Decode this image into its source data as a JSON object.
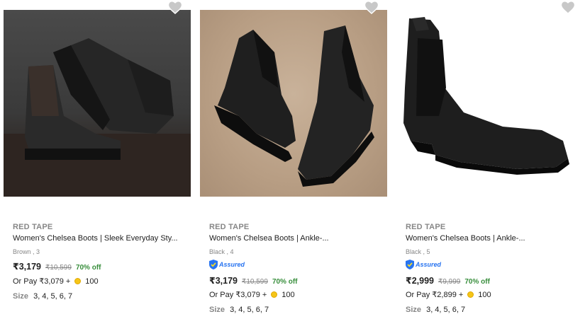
{
  "products": [
    {
      "brand": "RED TAPE",
      "title": "Women's Chelsea Boots | Sleek Everyday Sty...",
      "variant": "Brown , 3",
      "price": "₹3,179",
      "mrp": "₹10,599",
      "discount": "70% off",
      "pay_prefix": "Or Pay ₹3,079 +",
      "coins": "100",
      "size_label": "Size",
      "sizes": "3, 4, 5, 6, 7",
      "assured": false,
      "icons": {
        "wishlist": "heart-icon",
        "coin": "supercoin-icon"
      }
    },
    {
      "brand": "RED TAPE",
      "title": "Women's Chelsea Boots | Ankle-...",
      "variant": "Black , 4",
      "assured_label": "Assured",
      "price": "₹3,179",
      "mrp": "₹10,599",
      "discount": "70% off",
      "pay_prefix": "Or Pay ₹3,079 +",
      "coins": "100",
      "size_label": "Size",
      "sizes": "3, 4, 5, 6, 7",
      "assured": true
    },
    {
      "brand": "RED TAPE",
      "title": "Women's Chelsea Boots | Ankle-...",
      "variant": "Black , 5",
      "assured_label": "Assured",
      "price": "₹2,999",
      "mrp": "₹9,999",
      "discount": "70% off",
      "pay_prefix": "Or Pay ₹2,899 +",
      "coins": "100",
      "size_label": "Size",
      "sizes": "3, 4, 5, 6, 7",
      "assured": true
    }
  ],
  "colors": {
    "discount": "#388e3c",
    "assured": "#2874f0",
    "muted": "#878787",
    "wishlist": "#c8c8c8"
  }
}
